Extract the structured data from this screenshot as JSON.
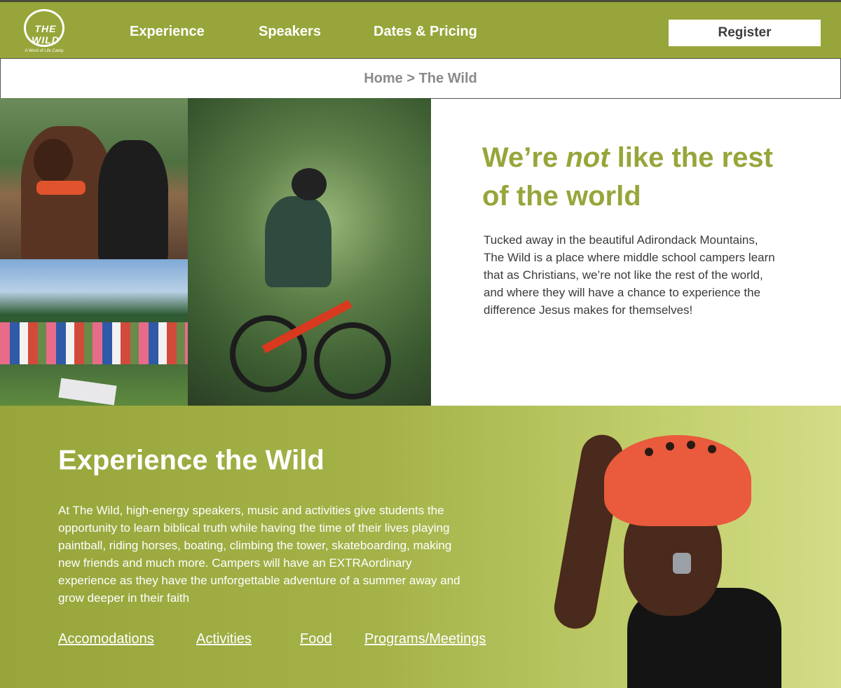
{
  "header": {
    "logo_text": "THE WILD",
    "logo_tagline": "A Word of Life Camp",
    "nav": [
      {
        "label": "Experience"
      },
      {
        "label": "Speakers"
      },
      {
        "label": "Dates & Pricing"
      }
    ],
    "register_label": "Register"
  },
  "breadcrumb": {
    "text": "Home > The Wild"
  },
  "intro": {
    "title_part1": "We’re ",
    "title_emphasis": "not",
    "title_part2": " like the rest of the world",
    "body": "Tucked away in the beautiful Adirondack Mountains, The Wild is a place where middle school campers learn that as Christians, we’re not like the rest of the world, and where they will have a chance to experience the difference Jesus makes for themselves!"
  },
  "experience": {
    "title": "Experience the Wild",
    "body": "At The Wild, high-energy speakers, music and activities give students the opportunity to learn biblical truth while having the time of their lives playing paintball, riding horses, boating, climbing the tower, skateboarding, making new friends and much more. Campers will have an EXTRAordinary experience as they have the unforgettable adventure of a summer away and grow deeper in their faith",
    "links": [
      {
        "label": "Accomodations"
      },
      {
        "label": "Activities"
      },
      {
        "label": "Food"
      },
      {
        "label": "Programs/Meetings"
      }
    ]
  },
  "colors": {
    "brand_green": "#98a53a",
    "light_green": "#d3dc87",
    "text_dark": "#3a3a3a",
    "breadcrumb_gray": "#8a8a8a"
  },
  "icons": [
    "logo-emblem"
  ]
}
